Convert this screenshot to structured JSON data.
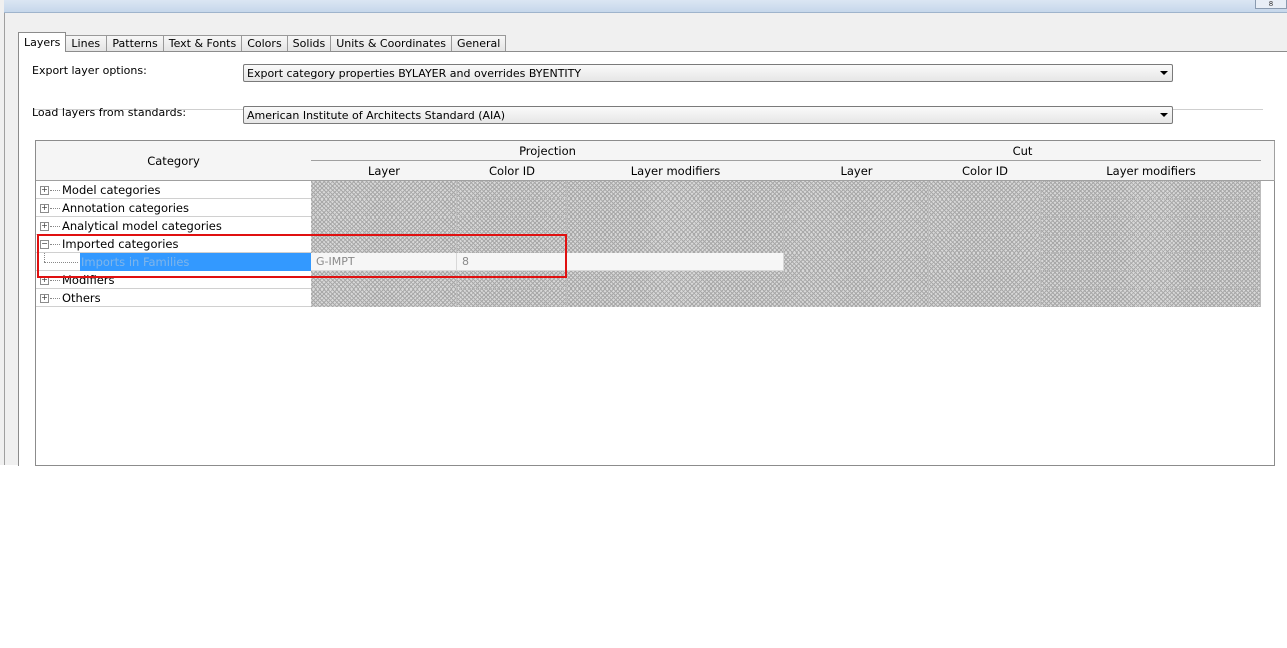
{
  "title_button": "8",
  "tabs": [
    "Layers",
    "Lines",
    "Patterns",
    "Text & Fonts",
    "Colors",
    "Solids",
    "Units & Coordinates",
    "General"
  ],
  "export_layer_options": {
    "label": "Export layer options:",
    "value": "Export category properties BYLAYER and overrides BYENTITY"
  },
  "load_layers": {
    "label": "Load layers from standards:",
    "value": "American Institute of Architects Standard (AIA)"
  },
  "table": {
    "category_header": "Category",
    "projection_header": "Projection",
    "cut_header": "Cut",
    "sub_headers": [
      "Layer",
      "Color ID",
      "Layer modifiers",
      "Layer",
      "Color ID",
      "Layer modifiers"
    ],
    "rows": [
      {
        "label": "Model categories",
        "expander": "+"
      },
      {
        "label": "Annotation categories",
        "expander": "+"
      },
      {
        "label": "Analytical model categories",
        "expander": "+"
      },
      {
        "label": "Imported categories",
        "expander": "−"
      },
      {
        "label": "Imports in Families",
        "layer": "G-IMPT",
        "color_id": "8"
      },
      {
        "label": "Modifiers",
        "expander": "+"
      },
      {
        "label": "Others",
        "expander": "+"
      }
    ]
  },
  "highlight_color": "#e01010",
  "selection_color": "#3399ff"
}
